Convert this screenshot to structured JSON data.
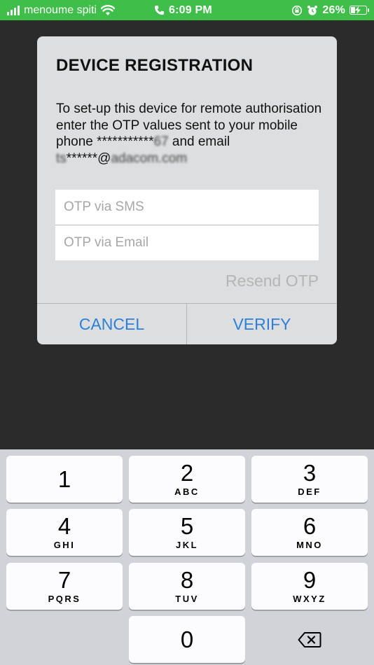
{
  "status_bar": {
    "carrier": "menoume spiti",
    "time": "6:09 PM",
    "battery": "26%",
    "battery_level": 0.26
  },
  "dialog": {
    "title": "DEVICE REGISTRATION",
    "message_lead": "To set-up this device for remote authorisation enter the OTP values sent to your mobile phone ",
    "masked_phone": "***********",
    "phone_tail": "67",
    "message_mid": " and email ",
    "email_head": "ts",
    "email_mask": "******@",
    "email_domain": "adacom.com",
    "sms_placeholder": "OTP via SMS",
    "email_placeholder": "OTP via Email",
    "resend_label": "Resend OTP",
    "cancel_label": "CANCEL",
    "verify_label": "VERIFY"
  },
  "keypad": {
    "keys": [
      {
        "digit": "1",
        "letters": ""
      },
      {
        "digit": "2",
        "letters": "ABC"
      },
      {
        "digit": "3",
        "letters": "DEF"
      },
      {
        "digit": "4",
        "letters": "GHI"
      },
      {
        "digit": "5",
        "letters": "JKL"
      },
      {
        "digit": "6",
        "letters": "MNO"
      },
      {
        "digit": "7",
        "letters": "PQRS"
      },
      {
        "digit": "8",
        "letters": "TUV"
      },
      {
        "digit": "9",
        "letters": "WXYZ"
      },
      {
        "digit": "0",
        "letters": ""
      }
    ],
    "delete_icon": "backspace-icon"
  },
  "colors": {
    "status_bar": "#3fbf4a",
    "accent": "#2d7fd7",
    "dialog_bg": "#dcdedf",
    "keypad_bg": "#d1d3d8"
  }
}
